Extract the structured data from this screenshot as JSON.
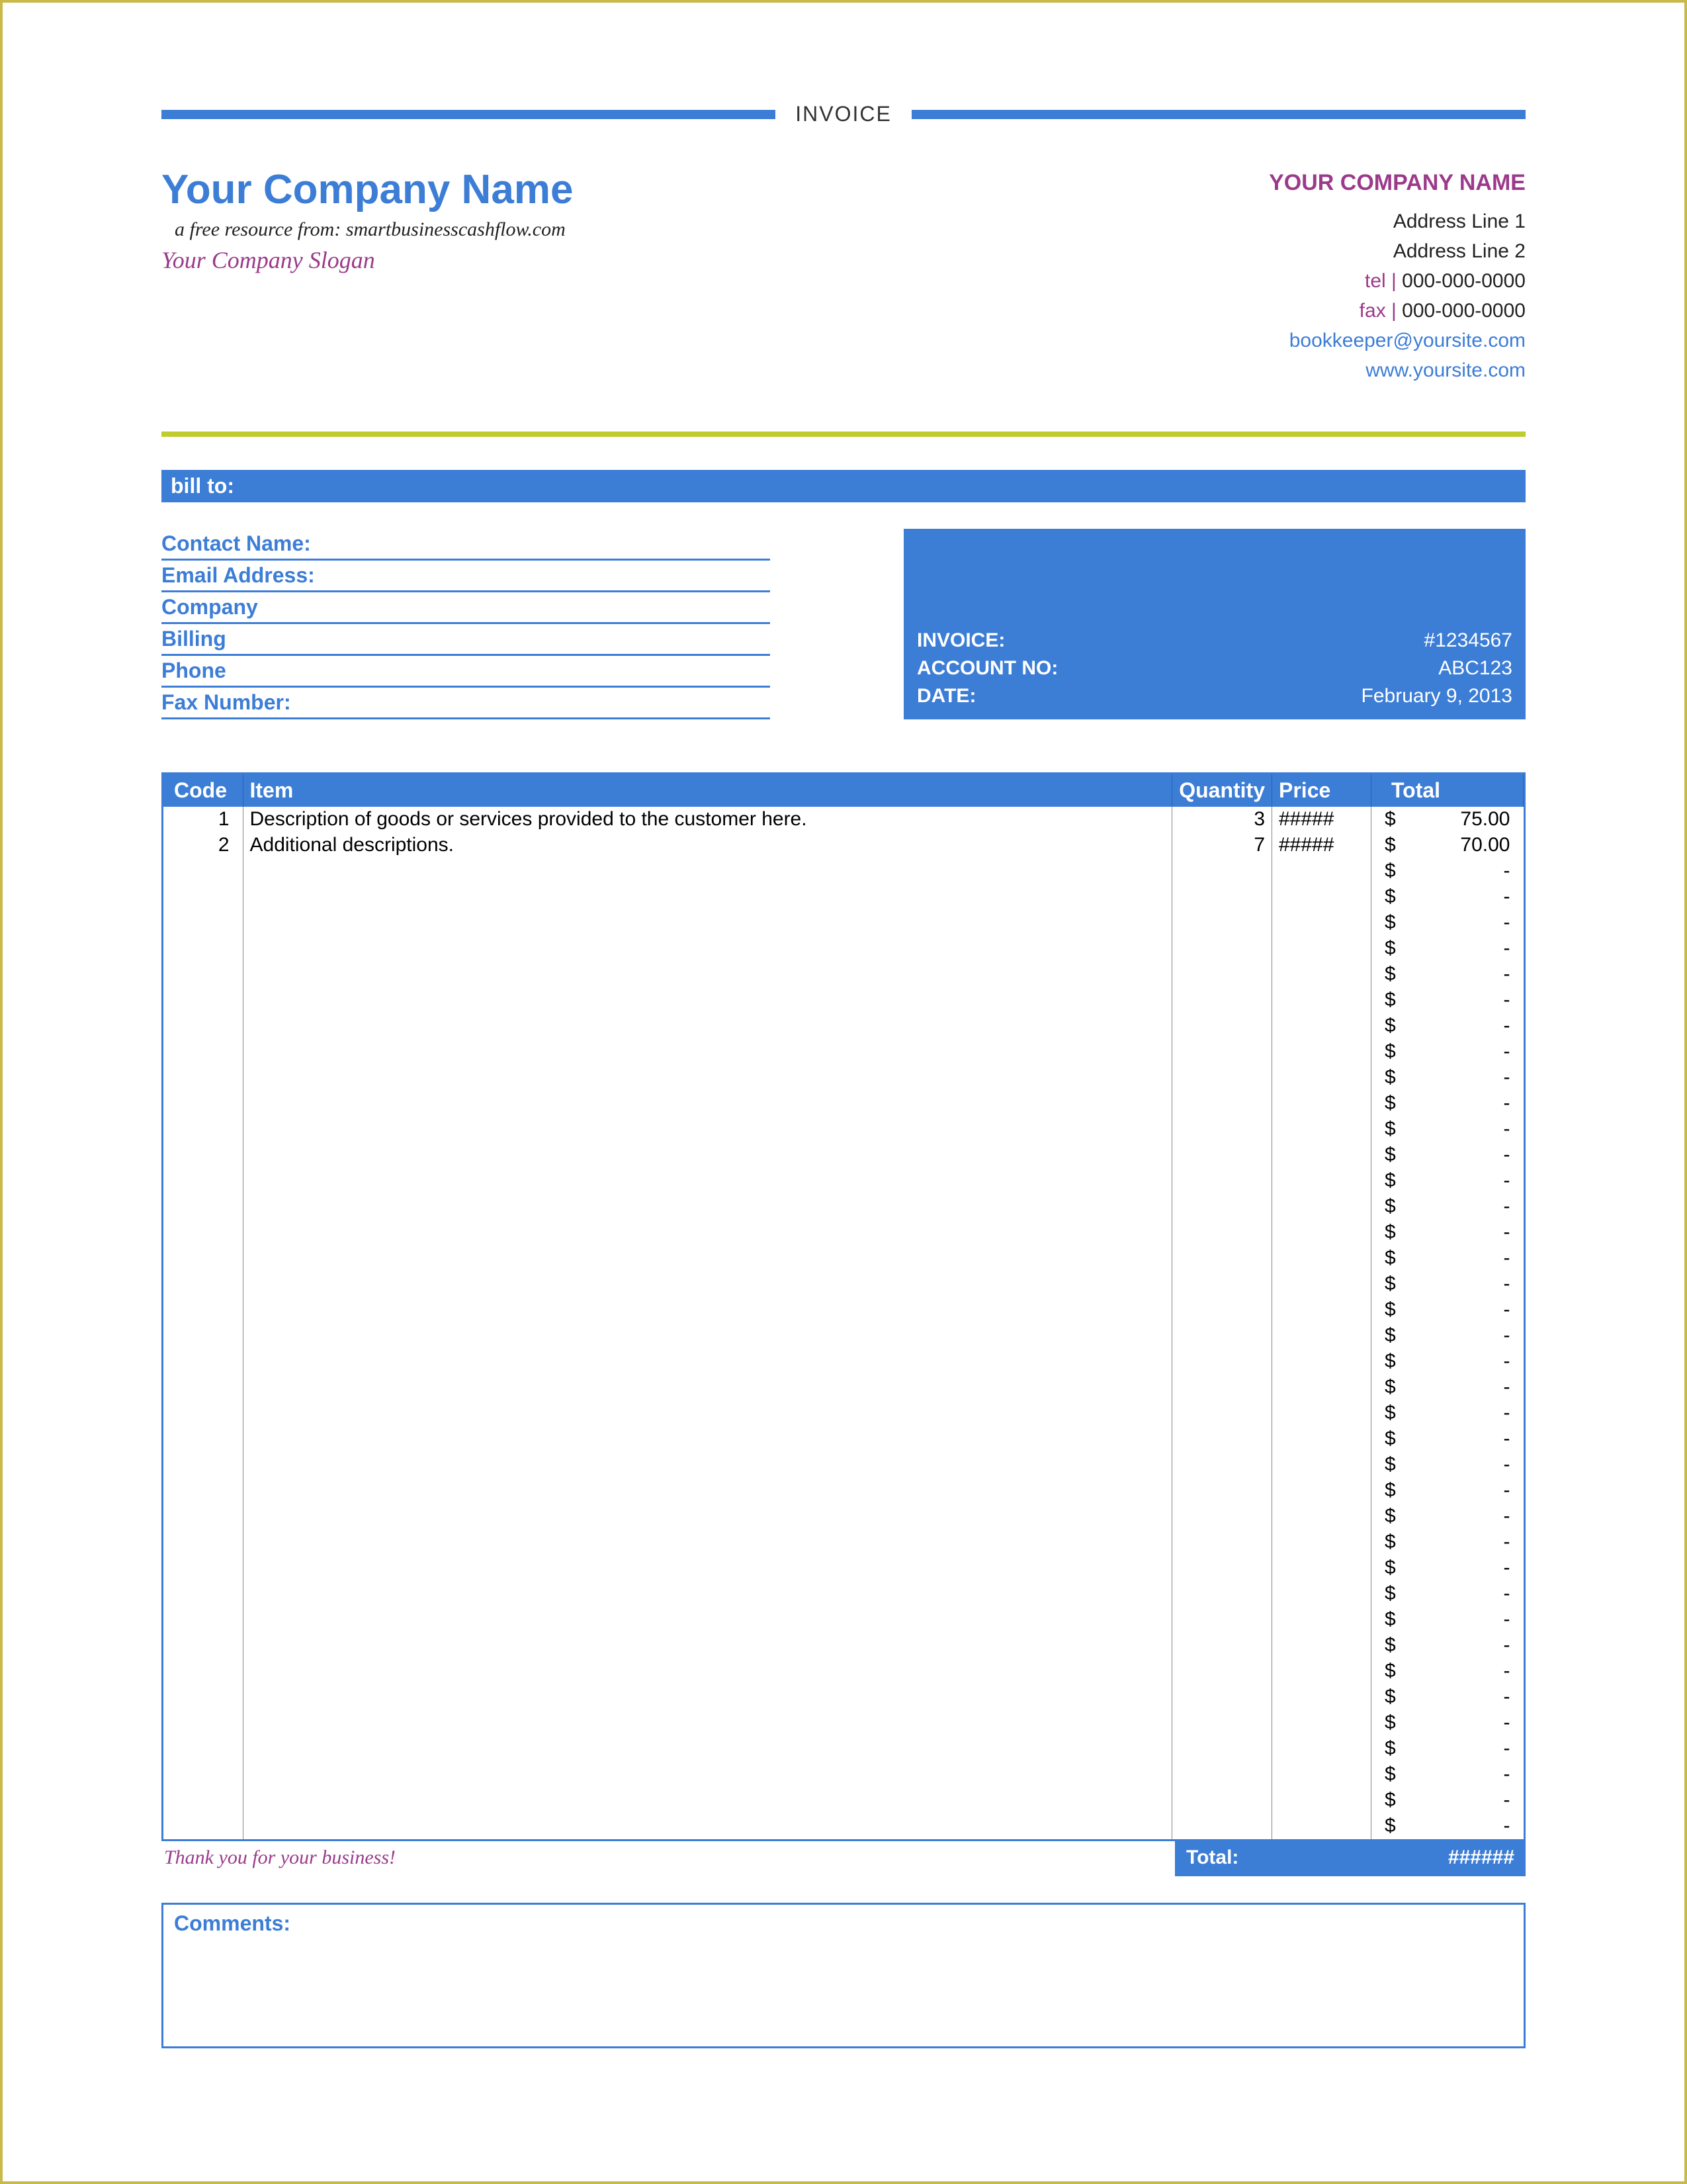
{
  "doc_title": "INVOICE",
  "header": {
    "company_name": "Your Company Name",
    "resource_line": "a free resource from: smartbusinesscashflow.com",
    "slogan": "Your Company Slogan",
    "right": {
      "name": "YOUR COMPANY NAME",
      "addr1": "Address Line 1",
      "addr2": "Address Line 2",
      "tel_label": "tel |",
      "tel": " 000-000-0000",
      "fax_label": "fax |",
      "fax": " 000-000-0000",
      "email": "bookkeeper@yoursite.com",
      "web": "www.yoursite.com"
    }
  },
  "billto_bar": "bill to:",
  "billto_labels": {
    "contact": "Contact Name:",
    "email": "Email Address:",
    "company": "Company",
    "billing": "Billing",
    "phone": "Phone",
    "fax": "Fax Number:"
  },
  "meta": {
    "invoice_label": "INVOICE:",
    "invoice_value": "#1234567",
    "account_label": "ACCOUNT NO:",
    "account_value": "ABC123",
    "date_label": "DATE:",
    "date_value": "February 9, 2013"
  },
  "columns": {
    "code": "Code",
    "item": "Item",
    "qty": "Quantity",
    "price": "Price",
    "total": "Total"
  },
  "rows": [
    {
      "code": "1",
      "item": "Description of goods or services provided to the customer here.",
      "qty": "3",
      "price": "#####",
      "total": "75.00"
    },
    {
      "code": "2",
      "item": "Additional descriptions.",
      "qty": "7",
      "price": "#####",
      "total": "70.00"
    },
    {
      "code": "",
      "item": "",
      "qty": "",
      "price": "",
      "total": "-"
    },
    {
      "code": "",
      "item": "",
      "qty": "",
      "price": "",
      "total": "-"
    },
    {
      "code": "",
      "item": "",
      "qty": "",
      "price": "",
      "total": "-"
    },
    {
      "code": "",
      "item": "",
      "qty": "",
      "price": "",
      "total": "-"
    },
    {
      "code": "",
      "item": "",
      "qty": "",
      "price": "",
      "total": "-"
    },
    {
      "code": "",
      "item": "",
      "qty": "",
      "price": "",
      "total": "-"
    },
    {
      "code": "",
      "item": "",
      "qty": "",
      "price": "",
      "total": "-"
    },
    {
      "code": "",
      "item": "",
      "qty": "",
      "price": "",
      "total": "-"
    },
    {
      "code": "",
      "item": "",
      "qty": "",
      "price": "",
      "total": "-"
    },
    {
      "code": "",
      "item": "",
      "qty": "",
      "price": "",
      "total": "-"
    },
    {
      "code": "",
      "item": "",
      "qty": "",
      "price": "",
      "total": "-"
    },
    {
      "code": "",
      "item": "",
      "qty": "",
      "price": "",
      "total": "-"
    },
    {
      "code": "",
      "item": "",
      "qty": "",
      "price": "",
      "total": "-"
    },
    {
      "code": "",
      "item": "",
      "qty": "",
      "price": "",
      "total": "-"
    },
    {
      "code": "",
      "item": "",
      "qty": "",
      "price": "",
      "total": "-"
    },
    {
      "code": "",
      "item": "",
      "qty": "",
      "price": "",
      "total": "-"
    },
    {
      "code": "",
      "item": "",
      "qty": "",
      "price": "",
      "total": "-"
    },
    {
      "code": "",
      "item": "",
      "qty": "",
      "price": "",
      "total": "-"
    },
    {
      "code": "",
      "item": "",
      "qty": "",
      "price": "",
      "total": "-"
    },
    {
      "code": "",
      "item": "",
      "qty": "",
      "price": "",
      "total": "-"
    },
    {
      "code": "",
      "item": "",
      "qty": "",
      "price": "",
      "total": "-"
    },
    {
      "code": "",
      "item": "",
      "qty": "",
      "price": "",
      "total": "-"
    },
    {
      "code": "",
      "item": "",
      "qty": "",
      "price": "",
      "total": "-"
    },
    {
      "code": "",
      "item": "",
      "qty": "",
      "price": "",
      "total": "-"
    },
    {
      "code": "",
      "item": "",
      "qty": "",
      "price": "",
      "total": "-"
    },
    {
      "code": "",
      "item": "",
      "qty": "",
      "price": "",
      "total": "-"
    },
    {
      "code": "",
      "item": "",
      "qty": "",
      "price": "",
      "total": "-"
    },
    {
      "code": "",
      "item": "",
      "qty": "",
      "price": "",
      "total": "-"
    },
    {
      "code": "",
      "item": "",
      "qty": "",
      "price": "",
      "total": "-"
    },
    {
      "code": "",
      "item": "",
      "qty": "",
      "price": "",
      "total": "-"
    },
    {
      "code": "",
      "item": "",
      "qty": "",
      "price": "",
      "total": "-"
    },
    {
      "code": "",
      "item": "",
      "qty": "",
      "price": "",
      "total": "-"
    },
    {
      "code": "",
      "item": "",
      "qty": "",
      "price": "",
      "total": "-"
    },
    {
      "code": "",
      "item": "",
      "qty": "",
      "price": "",
      "total": "-"
    },
    {
      "code": "",
      "item": "",
      "qty": "",
      "price": "",
      "total": "-"
    },
    {
      "code": "",
      "item": "",
      "qty": "",
      "price": "",
      "total": "-"
    },
    {
      "code": "",
      "item": "",
      "qty": "",
      "price": "",
      "total": "-"
    },
    {
      "code": "",
      "item": "",
      "qty": "",
      "price": "",
      "total": "-"
    }
  ],
  "thanks": "Thank you for your business!",
  "total_label": "Total:",
  "total_value": "######",
  "comments_label": "Comments:",
  "dollar": "$",
  "chart_data": {
    "type": "table",
    "title": "INVOICE",
    "columns": [
      "Code",
      "Item",
      "Quantity",
      "Price",
      "Total"
    ],
    "rows": [
      [
        1,
        "Description of goods or services provided to the customer here.",
        3,
        null,
        75.0
      ],
      [
        2,
        "Additional descriptions.",
        7,
        null,
        70.0
      ]
    ],
    "grand_total": null,
    "invoice_number": "#1234567",
    "account_number": "ABC123",
    "date": "February 9, 2013"
  }
}
